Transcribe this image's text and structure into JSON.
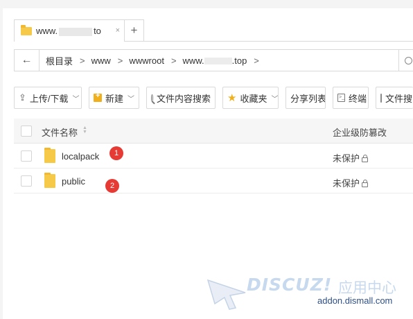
{
  "tab": {
    "title_prefix": "www.",
    "title_suffix": "to",
    "close": "×",
    "add": "+"
  },
  "address": {
    "back": "←",
    "crumbs": [
      "根目录",
      "www",
      "wwwroot",
      "www.",
      ".top"
    ],
    "separator": ">"
  },
  "toolbar": {
    "upload": "上传/下载",
    "new": "新建",
    "content_search": "文件内容搜索",
    "favorites": "收藏夹",
    "share_list": "分享列表",
    "terminal": "终端",
    "file_more": "文件搜"
  },
  "table": {
    "col_name": "文件名称",
    "col_protection": "企业级防篡改",
    "rows": [
      {
        "name": "localpack",
        "protection": "未保护",
        "badge": "1"
      },
      {
        "name": "public",
        "protection": "未保护",
        "badge": "2"
      }
    ]
  },
  "watermark": {
    "brand": "DISCUZ!",
    "cn": "应用中心",
    "url": "addon.dismall.com"
  },
  "colors": {
    "badge": "#e63a35",
    "folder": "#f7c948",
    "star": "#f0b01e"
  }
}
